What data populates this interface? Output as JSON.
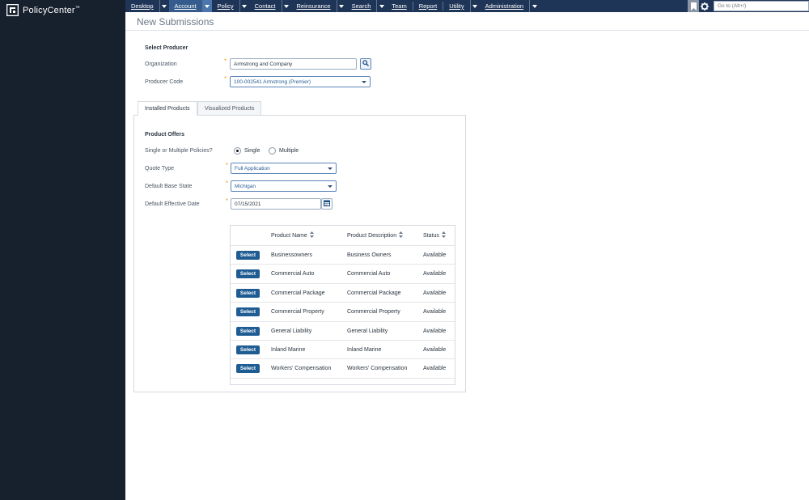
{
  "app": {
    "name": "PolicyCenter",
    "trademark": "™"
  },
  "nav": {
    "items": [
      {
        "label": "Desktop",
        "chevron": true,
        "active": false
      },
      {
        "label": "Account",
        "chevron": true,
        "active": true
      },
      {
        "label": "Policy",
        "chevron": true,
        "active": false
      },
      {
        "label": "Contact",
        "chevron": true,
        "active": false
      },
      {
        "label": "Reinsurance",
        "chevron": true,
        "active": false
      },
      {
        "label": "Search",
        "chevron": true,
        "active": false
      },
      {
        "label": "Team",
        "chevron": false,
        "active": false
      },
      {
        "label": "Report",
        "chevron": false,
        "active": false
      },
      {
        "label": "Utility",
        "chevron": true,
        "active": false
      },
      {
        "label": "Administration",
        "chevron": true,
        "active": false
      }
    ],
    "goto_placeholder": "Go to (Alt+/)"
  },
  "page": {
    "title": "New Submissions"
  },
  "producer": {
    "section_title": "Select Producer",
    "organization_label": "Organization",
    "organization_value": "Armstrong and Company",
    "producer_code_label": "Producer Code",
    "producer_code_value": "100-002541 Armstrong (Premier)"
  },
  "tabs": [
    {
      "label": "Installed Products",
      "active": true
    },
    {
      "label": "Visualized Products",
      "active": false
    }
  ],
  "offers": {
    "section_title": "Product Offers",
    "policies_label": "Single or Multiple Policies?",
    "single_label": "Single",
    "multiple_label": "Multiple",
    "selected": "Single",
    "quote_type_label": "Quote Type",
    "quote_type_value": "Full Application",
    "base_state_label": "Default Base State",
    "base_state_value": "Michigan",
    "effective_date_label": "Default Effective Date",
    "effective_date_value": "07/15/2021"
  },
  "products": {
    "columns": [
      "Product Name",
      "Product Description",
      "Status"
    ],
    "select_label": "Select",
    "rows": [
      {
        "name": "Businessowners",
        "description": "Business Owners",
        "status": "Available"
      },
      {
        "name": "Commercial Auto",
        "description": "Commercial Auto",
        "status": "Available"
      },
      {
        "name": "Commercial Package",
        "description": "Commercial Package",
        "status": "Available"
      },
      {
        "name": "Commercial Property",
        "description": "Commercial Property",
        "status": "Available"
      },
      {
        "name": "General Liability",
        "description": "General Liability",
        "status": "Available"
      },
      {
        "name": "Inland Marine",
        "description": "Inland Marine",
        "status": "Available"
      },
      {
        "name": "Workers' Compensation",
        "description": "Workers' Compensation",
        "status": "Available"
      }
    ]
  },
  "colors": {
    "sidebar": "#17202d",
    "nav": "#1f3557",
    "nav_active": "#355c8c",
    "button": "#1f5c93",
    "required": "#e8a038"
  }
}
